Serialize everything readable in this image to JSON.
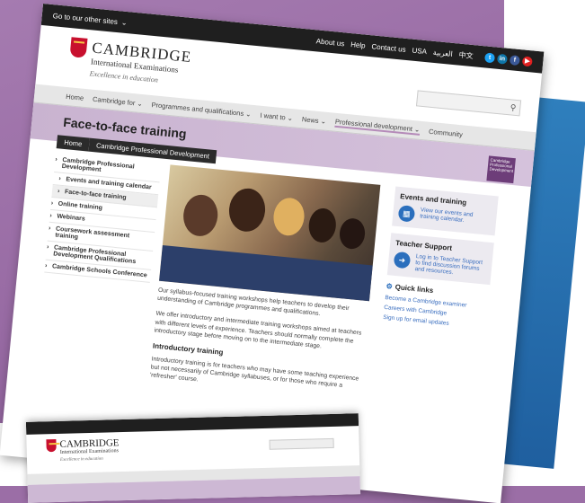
{
  "topbar": {
    "other_sites": "Go to our other sites",
    "links": [
      "About us",
      "Help",
      "Contact us",
      "USA",
      "العربية",
      "中文"
    ],
    "social": [
      {
        "name": "twitter",
        "glyph": "t",
        "color": "#1da1f2"
      },
      {
        "name": "linkedin",
        "glyph": "in",
        "color": "#0e76a8"
      },
      {
        "name": "facebook",
        "glyph": "f",
        "color": "#3b5998"
      },
      {
        "name": "youtube",
        "glyph": "▶",
        "color": "#e02020"
      }
    ]
  },
  "logo": {
    "name": "CAMBRIDGE",
    "subtitle": "International Examinations",
    "tagline": "Excellence in education"
  },
  "search": {
    "icon": "search-icon",
    "glyph": "⚲"
  },
  "nav": {
    "items": [
      "Home",
      "Cambridge for ⌄",
      "Programmes and qualifications ⌄",
      "I want to ⌄",
      "News ⌄",
      "Professional development ⌄",
      "Community"
    ],
    "active_index": 5
  },
  "banner": {
    "title": "Face-to-face training",
    "breadcrumb": [
      "Home",
      "Cambridge Professional Development"
    ],
    "badge": "Cambridge Professional Development"
  },
  "sidebar": {
    "items": [
      {
        "label": "Cambridge Professional Development",
        "sub": false,
        "selected": false
      },
      {
        "label": "Events and training calendar",
        "sub": true,
        "selected": false
      },
      {
        "label": "Face-to-face training",
        "sub": true,
        "selected": true
      },
      {
        "label": "Online training",
        "sub": false,
        "selected": false
      },
      {
        "label": "Webinars",
        "sub": false,
        "selected": false
      },
      {
        "label": "Coursework assessment training",
        "sub": false,
        "selected": false
      },
      {
        "label": "Cambridge Professional Development Qualifications",
        "sub": false,
        "selected": false
      },
      {
        "label": "Cambridge Schools Conference",
        "sub": false,
        "selected": false
      }
    ]
  },
  "main": {
    "p1": "Our syllabus-focused training workshops help teachers to develop their understanding of Cambridge programmes and qualifications.",
    "p2": "We offer introductory and intermediate training workshops aimed at teachers with different levels of experience. Teachers should normally complete the introductory stage before moving on to the intermediate stage.",
    "h3": "Introductory training",
    "p3": "Introductory training is for teachers who may have some teaching experience but not necessarily of Cambridge syllabuses, or for those who require a 'refresher' course."
  },
  "right": {
    "events": {
      "title": "Events and training",
      "text": "View our events and training calendar.",
      "icon": "calendar-icon"
    },
    "support": {
      "title": "Teacher Support",
      "text": "Log in to Teacher Support to find discussion forums and resources.",
      "icon": "login-icon"
    },
    "quick_links": {
      "title": "Quick links",
      "items": [
        "Become a Cambridge examiner",
        "Careers with Cambridge",
        "Sign up for email updates"
      ]
    }
  },
  "colors": {
    "accent": "#b58bb9",
    "brand_red": "#c8102e",
    "link": "#3a6ebf",
    "frame_blue": "#2f7fbd"
  }
}
